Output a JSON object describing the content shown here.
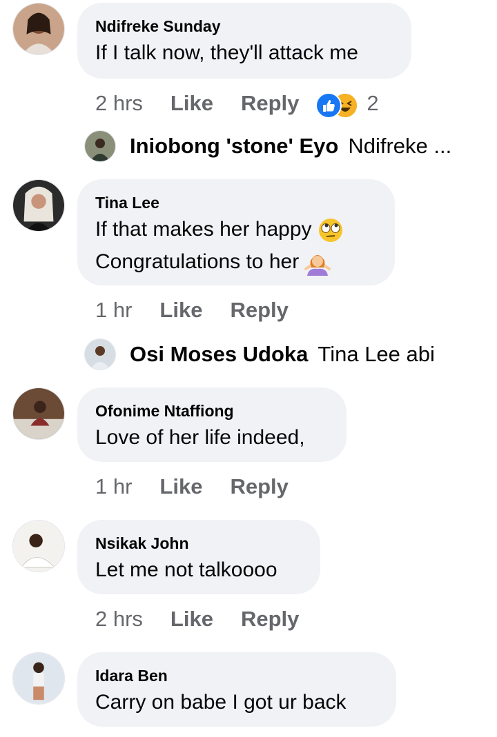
{
  "comments": [
    {
      "author": "Ndifreke Sunday",
      "text": "If I talk now, they'll attack me",
      "time": "2 hrs",
      "like": "Like",
      "reply": "Reply",
      "reaction_count": "2",
      "reply_preview": {
        "name": "Iniobong 'stone' Eyo",
        "snippet": "Ndifreke ..."
      }
    },
    {
      "author": "Tina Lee",
      "text_line1": "If that makes her happy",
      "text_line2": "Congratulations to her",
      "time": "1 hr",
      "like": "Like",
      "reply": "Reply",
      "reply_preview": {
        "name": "Osi Moses Udoka",
        "snippet": "Tina Lee abi"
      }
    },
    {
      "author": "Ofonime Ntaffiong",
      "text": "Love of her life indeed,",
      "time": "1 hr",
      "like": "Like",
      "reply": "Reply"
    },
    {
      "author": "Nsikak John",
      "text": "Let me not talkoooo",
      "time": "2 hrs",
      "like": "Like",
      "reply": "Reply"
    },
    {
      "author": "Idara Ben",
      "text": "Carry on babe I got ur back"
    }
  ],
  "colors": {
    "bubble": "#f0f2f5",
    "meta": "#65676b",
    "like_blue": "#1877f2",
    "haha_yellow": "#f7b125"
  }
}
